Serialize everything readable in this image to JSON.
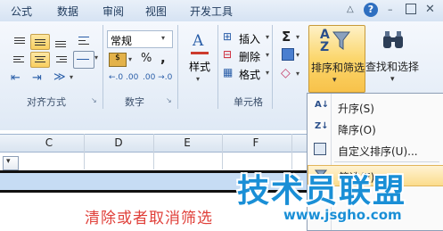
{
  "tabs": [
    "公式",
    "数据",
    "审阅",
    "视图",
    "开发工具"
  ],
  "tab_icons": [
    "caret-up-icon",
    "help-icon",
    "minimize-icon",
    "restore-icon",
    "close-icon"
  ],
  "groups": {
    "alignment": {
      "label": "对齐方式"
    },
    "number": {
      "label": "数字",
      "format_value": "常规",
      "percent": "%",
      "comma": ","
    },
    "styles": {
      "label": "样式"
    },
    "cells": {
      "label": "单元格",
      "insert": "插入",
      "delete": "删除",
      "format": "格式"
    },
    "editing": {
      "sort_filter": "排序和筛选",
      "find_select": "查找和选择"
    }
  },
  "columns": [
    "C",
    "D",
    "E",
    "F"
  ],
  "menu": {
    "items": [
      {
        "label": "升序(S)",
        "icon": "sort-asc-icon"
      },
      {
        "label": "降序(O)",
        "icon": "sort-desc-icon"
      },
      {
        "label": "自定义排序(U)...",
        "icon": "custom-sort-icon"
      },
      {
        "label": "筛选(F)",
        "icon": "filter-icon"
      }
    ]
  },
  "caption": "清除或者取消筛选",
  "watermark": {
    "text": "技术员联盟",
    "url": "www.jsgho.com"
  },
  "colors": {
    "selected_button": "#f9cf5f",
    "watermark": "#1a8fd6",
    "caption": "#e0403a",
    "row_highlight": "#c6dcf4"
  }
}
